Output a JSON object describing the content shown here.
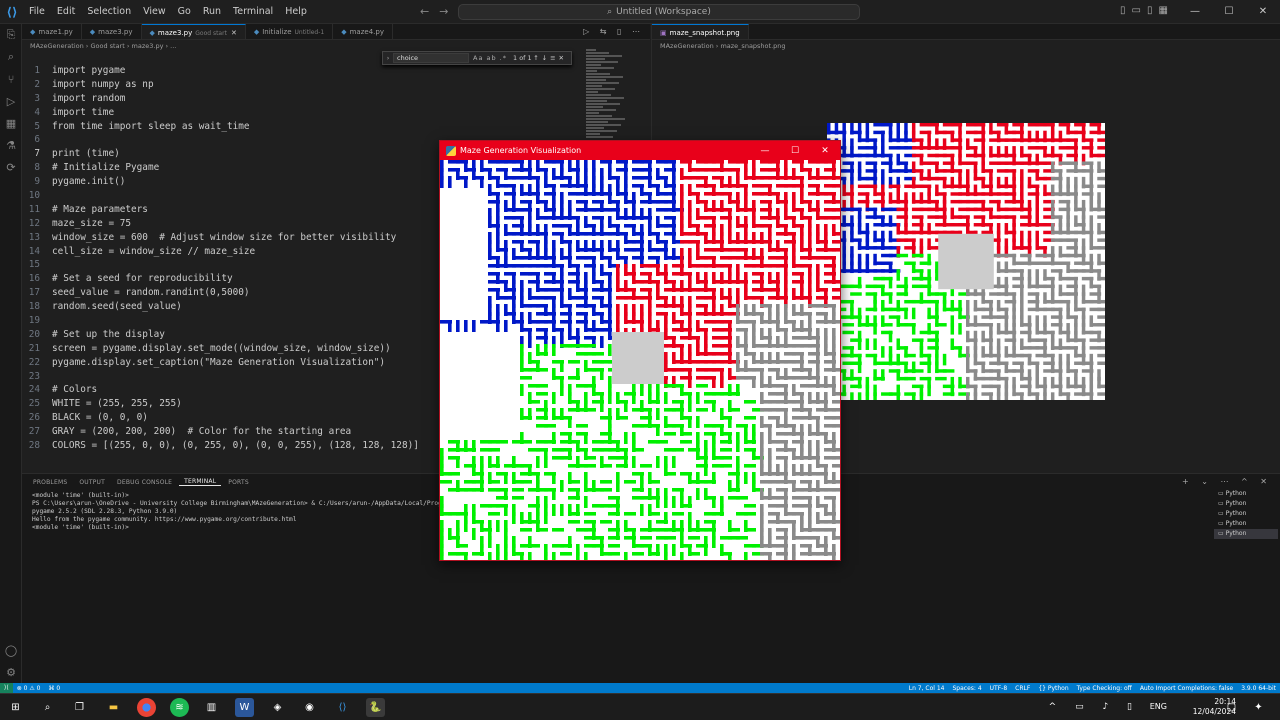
{
  "titlebar": {
    "menu": [
      "File",
      "Edit",
      "Selection",
      "View",
      "Go",
      "Run",
      "Terminal",
      "Help"
    ],
    "search": "Untitled (Workspace)"
  },
  "tabs_left": [
    {
      "label": "maze1.py",
      "desc": "",
      "active": false
    },
    {
      "label": "maze3.py",
      "desc": "",
      "active": false
    },
    {
      "label": "maze3.py",
      "desc": "Good start",
      "active": true
    },
    {
      "label": "Initialize",
      "desc": "Untitled-1",
      "active": false
    },
    {
      "label": "maze4.py",
      "desc": "",
      "active": false
    }
  ],
  "breadcrumb_left": "MAzeGeneration  ›  Good start  ›  maze3.py  ›  ...",
  "find": {
    "value": "choice",
    "count": "1 of 1"
  },
  "code_lines": [
    "import pygame",
    "import numpy as np",
    "import random",
    "import time",
    "from time import sleep as wait_time",
    "",
    "print (time)",
    "# Initialize Pygame",
    "pygame.init()",
    "",
    "# Maze parameters",
    "maze_size = 75",
    "window_size = 600  # Adjust window size for better visibility",
    "cell_size = window_size // maze_size",
    "",
    "# Set a seed for reproducibility",
    "seed_value = random.randint(0,5000)",
    "random.seed(seed_value)",
    "",
    "# Set up the display",
    "screen = pygame.display.set_mode((window_size, window_size))",
    "pygame.display.set_caption(\"Maze Generation Visualization\")",
    "",
    "# Colors",
    "WHITE = (255, 255, 255)",
    "BLACK = (0, 0, 0)",
    "GRAY = (200, 200, 200)  # Color for the starting area",
    "COLORS = [(255, 0, 0), (0, 255, 0), (0, 0, 255), (128, 128, 128)]"
  ],
  "tabs_right": [
    {
      "label": "maze_snapshot.png"
    }
  ],
  "breadcrumb_right": "MAzeGeneration  ›  maze_snapshot.png",
  "panel": {
    "tabs": [
      "PROBLEMS",
      "OUTPUT",
      "DEBUG CONSOLE",
      "TERMINAL",
      "PORTS"
    ],
    "active_tab": 3,
    "terminal_lines": [
      "<module 'time' (built-in)>",
      "PS C:\\Users\\arun-\\OneDrive - University College Birmingham\\MAzeGeneration> & C:/Users/arun-/AppData/Local/Programs/Python/P",
      "pygame 2.5.2 (SDL 2.28.3, Python 3.9.0)",
      "Hello from the pygame community. https://www.pygame.org/contribute.html",
      "<module 'time' (built-in)>"
    ],
    "terminals": [
      "Python",
      "Python",
      "Python",
      "Python",
      "Python"
    ]
  },
  "status": {
    "left": [
      "⊗ 0  ⚠ 0",
      "⌘ 0"
    ],
    "right": [
      "Ln 7, Col 14",
      "Spaces: 4",
      "UTF-8",
      "CRLF",
      "{} Python",
      "Type Checking: off",
      "Auto Import Completions: false",
      "3.9.0 64-bit"
    ]
  },
  "pygame_window": {
    "title": "Maze Generation Visualization",
    "colors": {
      "red": "#e8001a",
      "green": "#00f000",
      "blue": "#0018c8",
      "gray": "#8a8a8a",
      "start": "#cccccc"
    }
  },
  "taskbar": {
    "lang": "ENG",
    "time": "20:14",
    "date": "12/04/2024"
  }
}
